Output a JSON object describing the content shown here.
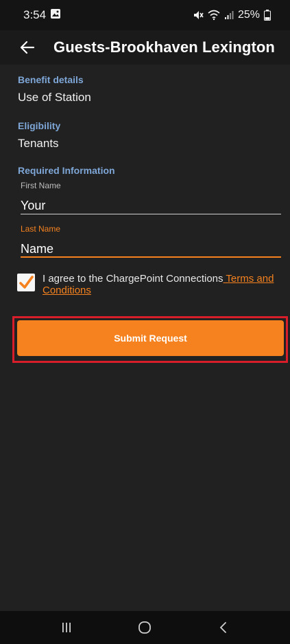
{
  "status_bar": {
    "time": "3:54",
    "battery_percent": "25%"
  },
  "app_bar": {
    "title": "Guests-Brookhaven Lexington"
  },
  "benefit": {
    "label": "Benefit details",
    "value": "Use of Station"
  },
  "eligibility": {
    "label": "Eligibility",
    "value": "Tenants"
  },
  "required_info": {
    "label": "Required Information",
    "first_name_label": "First Name",
    "first_name_value": "Your",
    "last_name_label": "Last Name",
    "last_name_value": "Name"
  },
  "agreement": {
    "text": "I agree to the ChargePoint Connections",
    "link": " Terms and Conditions",
    "checked": true
  },
  "submit": {
    "label": "Submit Request"
  },
  "colors": {
    "accent": "#f5821f",
    "section_label": "#7ea7d8",
    "highlight": "#d81e2a",
    "background": "#212121"
  }
}
